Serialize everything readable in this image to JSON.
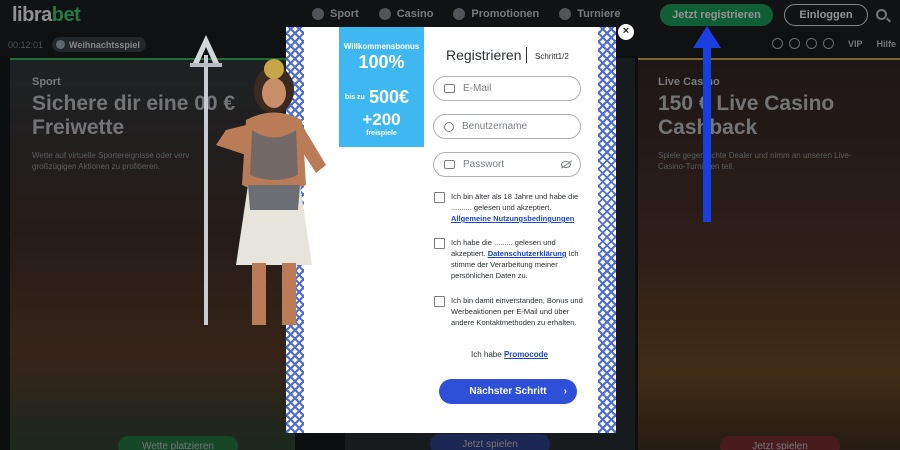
{
  "header": {
    "logo_main": "libra",
    "logo_accent": "bet",
    "nav": [
      {
        "label": "Sport",
        "icon": "soccer-ball-icon"
      },
      {
        "label": "Casino",
        "icon": "cards-icon"
      },
      {
        "label": "Promotionen",
        "icon": "gift-icon"
      },
      {
        "label": "Turniere",
        "icon": "trophy-icon"
      }
    ],
    "register_label": "Jetzt registrieren",
    "login_label": "Einloggen",
    "search_icon": "search-icon"
  },
  "subbar": {
    "clock": "00:12:01",
    "chip_label": "Weihnachtsspiel",
    "vip_label": "VIP",
    "help_label": "Hilfe"
  },
  "panels": {
    "left": {
      "label": "Sport",
      "heading_line1": "Sichere dir eine 00 €",
      "heading_line2": "Freiwette",
      "text_line1": "Wette auf virtuelle Sportereignisse oder verv",
      "text_line2": "großzügigen Aktionen zu profitieren.",
      "button": "Wette platzieren"
    },
    "mid": {
      "button": "Jetzt spielen"
    },
    "right": {
      "label": "Live Casino",
      "heading_line1": "150 € Live Casino",
      "heading_line2": "Cashback",
      "text_line1": "Spiele gegen echte Dealer und nimm an unseren Live-",
      "text_line2": "Casino-Turnieren teil.",
      "button": "Jetzt spielen"
    }
  },
  "modal": {
    "bonus": {
      "title": "Willkommensbonus",
      "percent": "100%",
      "upto": "bis zu",
      "amount": "500€",
      "spins": "+200",
      "spins_label": "freispiele"
    },
    "title": "Registrieren",
    "step": "Schritt1/2",
    "email_placeholder": "E-Mail",
    "username_placeholder": "Benutzername",
    "password_placeholder": "Passwort",
    "check1_text": "Ich bin älter als 18 Jahre und habe die .......... gelesen und akzeptiert.",
    "check1_link": "Allgemeine Nutzungsbedingungen",
    "check2_pre": "Ich habe die ......... gelesen und akzeptiert.",
    "check2_link": "Datenschutzerklärung",
    "check2_post": "Ich stimme der Verarbeitung meiner persönlichen Daten zu.",
    "check3_text": "Ich bin damit einverstanden, Bonus und Werbeaktionen per E-Mail und über andere Kontaktmethoden zu erhalten.",
    "promo_pre": "Ich habe",
    "promo_link": "Promocode",
    "next_button": "Nächster Schritt",
    "close_symbol": "×"
  },
  "colors": {
    "brand_green": "#14a257",
    "modal_blue": "#2e4fd8",
    "bonus_blue": "#3fb7f0",
    "arrow_blue": "#1a3fe0"
  }
}
